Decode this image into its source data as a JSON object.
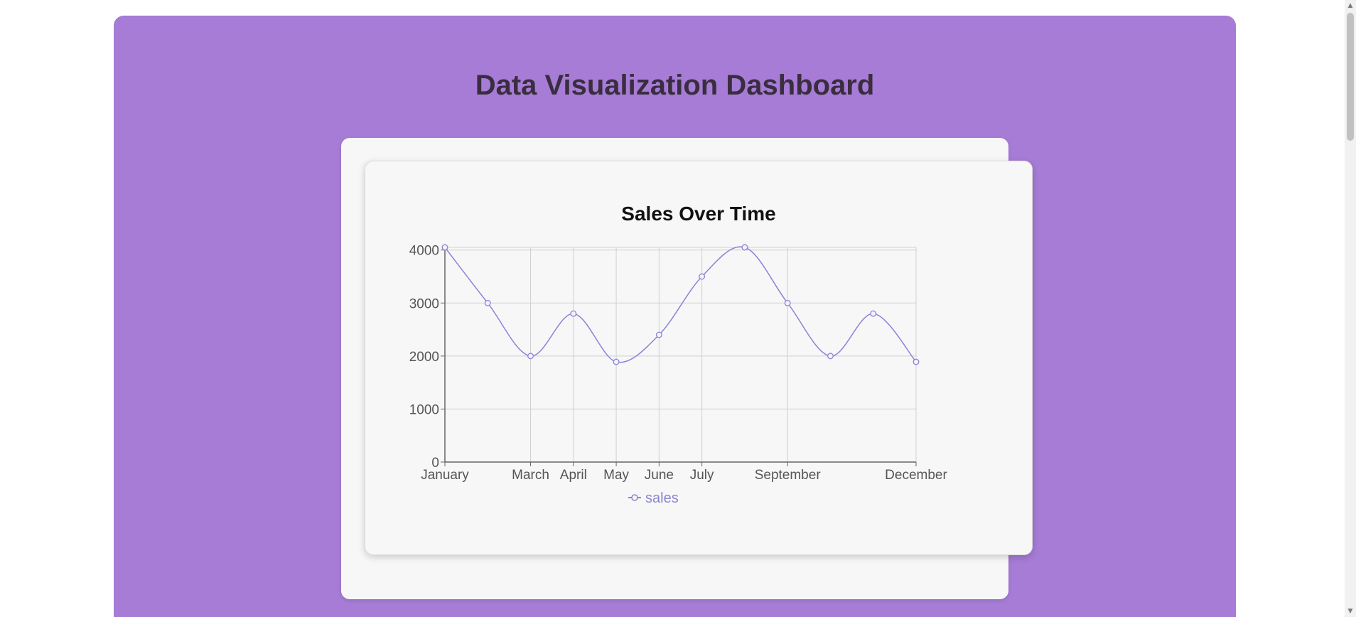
{
  "page": {
    "title": "Data Visualization Dashboard",
    "background_color": "#a67cd6",
    "accent_color": "#8a84d6"
  },
  "chart_data": {
    "type": "line",
    "title": "Sales Over Time",
    "xlabel": "",
    "ylabel": "",
    "x_axis": "time (months)",
    "x_tick_labels": [
      "January",
      "March",
      "April",
      "May",
      "June",
      "July",
      "September",
      "December"
    ],
    "points": [
      {
        "x": "January",
        "y": 4050
      },
      {
        "x": "February",
        "y": 3000
      },
      {
        "x": "March",
        "y": 2000
      },
      {
        "x": "April",
        "y": 2800
      },
      {
        "x": "May",
        "y": 1890
      },
      {
        "x": "June",
        "y": 2400
      },
      {
        "x": "July",
        "y": 3500
      },
      {
        "x": "August",
        "y": 4050
      },
      {
        "x": "September",
        "y": 3000
      },
      {
        "x": "October",
        "y": 2000
      },
      {
        "x": "November",
        "y": 2800
      },
      {
        "x": "December",
        "y": 1890
      }
    ],
    "series": [
      {
        "name": "sales",
        "color": "#8a84d6"
      }
    ],
    "y_ticks": [
      0,
      1000,
      2000,
      3000,
      4000
    ],
    "ylim": [
      0,
      4050
    ],
    "grid": true,
    "legend_position": "bottom-center",
    "curve": "smooth"
  }
}
